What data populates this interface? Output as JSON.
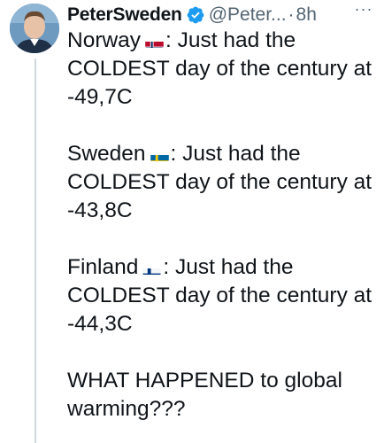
{
  "tweet": {
    "author_name": "PeterSweden",
    "handle": "@Peter...",
    "separator": "·",
    "time": "8h",
    "more_label": "···",
    "verified_icon": "verified-badge-icon",
    "paragraphs": [
      {
        "country": "Norway",
        "flag_icon": "norway-flag-icon",
        "text_after_flag": ": Just had the COLDEST day of the century at -49,7C"
      },
      {
        "country": "Sweden",
        "flag_icon": "sweden-flag-icon",
        "text_after_flag": ": Just had the COLDEST day of the century at -43,8C"
      },
      {
        "country": "Finland",
        "flag_icon": "finland-flag-icon",
        "text_after_flag": ": Just had the COLDEST day of the century at -44,3C"
      }
    ],
    "closing": "WHAT HAPPENED to global warming???"
  },
  "colors": {
    "text": "#0f1419",
    "secondary": "#536471",
    "verified": "#1d9bf0",
    "thread_line": "#cfd9de"
  }
}
